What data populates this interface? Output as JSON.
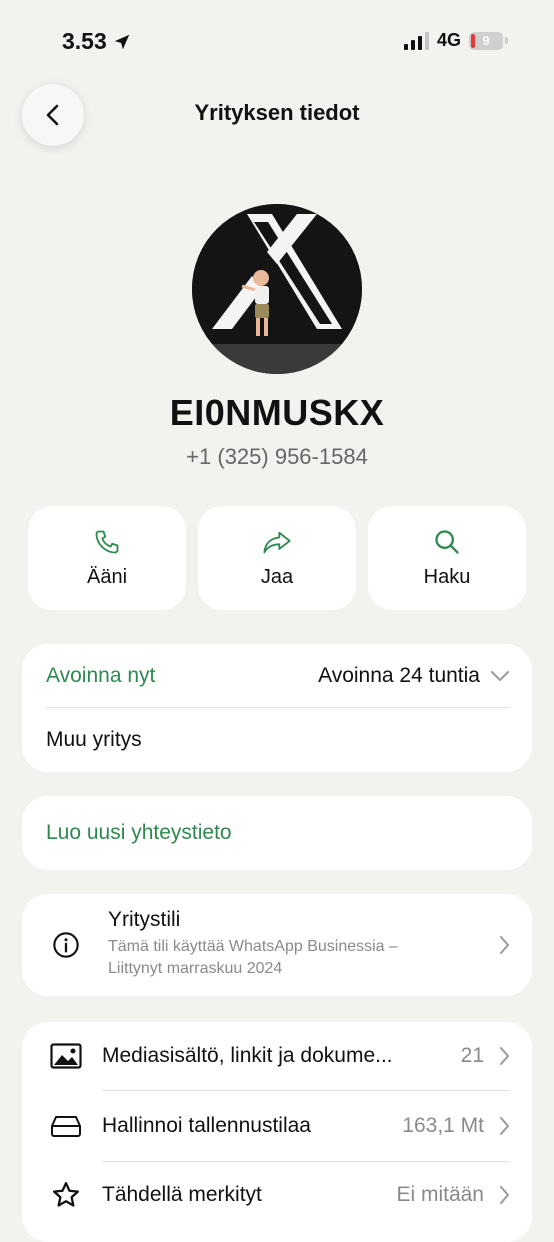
{
  "status": {
    "time": "3.53",
    "network": "4G",
    "battery": "9"
  },
  "header": {
    "title": "Yrityksen tiedot"
  },
  "profile": {
    "name": "EI0NMUSKX",
    "phone": "+1 (325) 956-1584"
  },
  "actions": [
    {
      "label": "Ääni",
      "icon": "phone-icon"
    },
    {
      "label": "Jaa",
      "icon": "share-icon"
    },
    {
      "label": "Haku",
      "icon": "search-icon"
    }
  ],
  "hours": {
    "status": "Avoinna nyt",
    "value": "Avoinna 24 tuntia",
    "category": "Muu yritys"
  },
  "contact": {
    "create_label": "Luo uusi yhteystieto"
  },
  "business": {
    "title": "Yritystili",
    "description_line1": "Tämä tili käyttää WhatsApp Businessia –",
    "description_line2": "Liittynyt marraskuu 2024"
  },
  "list": [
    {
      "label": "Mediasisältö, linkit ja dokume...",
      "value": "21",
      "icon": "image-icon"
    },
    {
      "label": "Hallinnoi tallennustilaa",
      "value": "163,1 Mt",
      "icon": "storage-icon"
    },
    {
      "label": "Tähdellä merkityt",
      "value": "Ei mitään",
      "icon": "star-icon"
    }
  ],
  "colors": {
    "accent": "#2f8a4f",
    "background": "#f2f2ef",
    "card": "#ffffff"
  }
}
